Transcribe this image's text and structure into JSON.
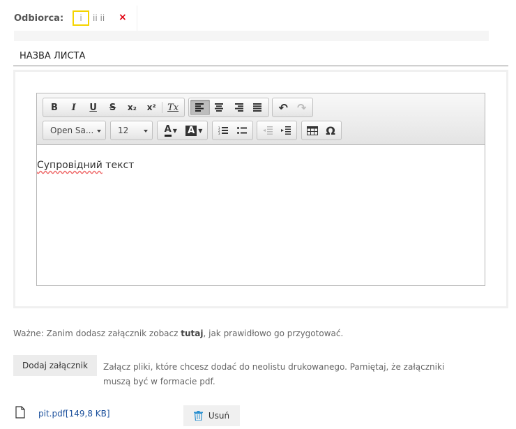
{
  "recipient": {
    "label": "Odbiorca:",
    "chip_text": "i",
    "name": "ii ii",
    "remove_glyph": "×"
  },
  "title_input": {
    "value": "НАЗВА ЛИСТА"
  },
  "editor": {
    "toolbar": {
      "bold": "B",
      "italic": "I",
      "underline": "U",
      "strike": "S",
      "subscript": "x₂",
      "superscript": "x²",
      "remove_format": "Tx",
      "align_left": "align-left-icon",
      "align_center": "align-center-icon",
      "align_right": "align-right-icon",
      "justify": "justify-icon",
      "undo": "↶",
      "redo": "↷",
      "font_combo": "Open Sa...",
      "size_combo": "12",
      "text_color": "A",
      "bg_color": "A",
      "special_char": "Ω"
    },
    "content_word1": "Супровідний",
    "content_word2": "текст"
  },
  "info": {
    "prefix": "Ważne: Zanim dodasz załącznik zobacz ",
    "link": "tutaj",
    "suffix": ", jak prawidłowo go przygotować."
  },
  "attach": {
    "button_label": "Dodaj załącznik",
    "description": "Załącz pliki, które chcesz dodać do neolistu drukowanego. Pamiętaj, że załączniki muszą być w formacie pdf."
  },
  "file": {
    "name": "pit.pdf[149,8 KB]",
    "delete_label": "Usuń"
  },
  "colors": {
    "accent_yellow": "#f5d400",
    "remove_red": "#e0000f",
    "link_blue": "#1a4f9c"
  }
}
